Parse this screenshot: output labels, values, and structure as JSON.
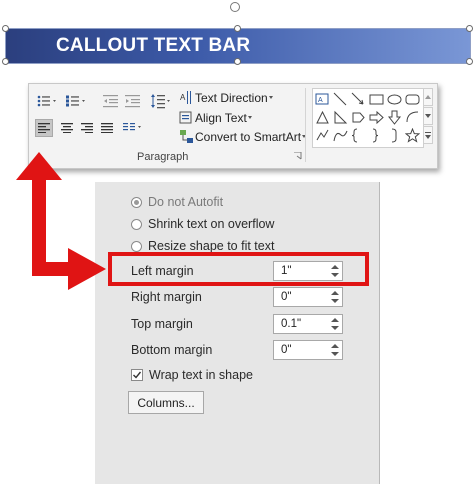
{
  "callout": {
    "title": "CALLOUT TEXT BAR"
  },
  "ribbon": {
    "text_direction": "Text Direction",
    "align_text": "Align Text",
    "convert_smartart": "Convert to SmartArt",
    "group_label": "Paragraph"
  },
  "panel": {
    "autofit_options": [
      {
        "label": "Do not Autofit",
        "selected": true,
        "enabled": false
      },
      {
        "label": "Shrink text on overflow",
        "selected": false,
        "enabled": true
      },
      {
        "label": "Resize shape to fit text",
        "selected": false,
        "enabled": true
      }
    ],
    "margins": {
      "left_label": "Left margin",
      "left_value": "1\"",
      "right_label": "Right margin",
      "right_value": "0\"",
      "top_label": "Top margin",
      "top_value": "0.1\"",
      "bottom_label": "Bottom margin",
      "bottom_value": "0\""
    },
    "wrap_label": "Wrap text in shape",
    "wrap_checked": true,
    "columns_label": "Columns..."
  },
  "colors": {
    "highlight": "#e01414",
    "callout_bar": "#2b3f7e",
    "panel_bg": "#e6e6e6"
  }
}
